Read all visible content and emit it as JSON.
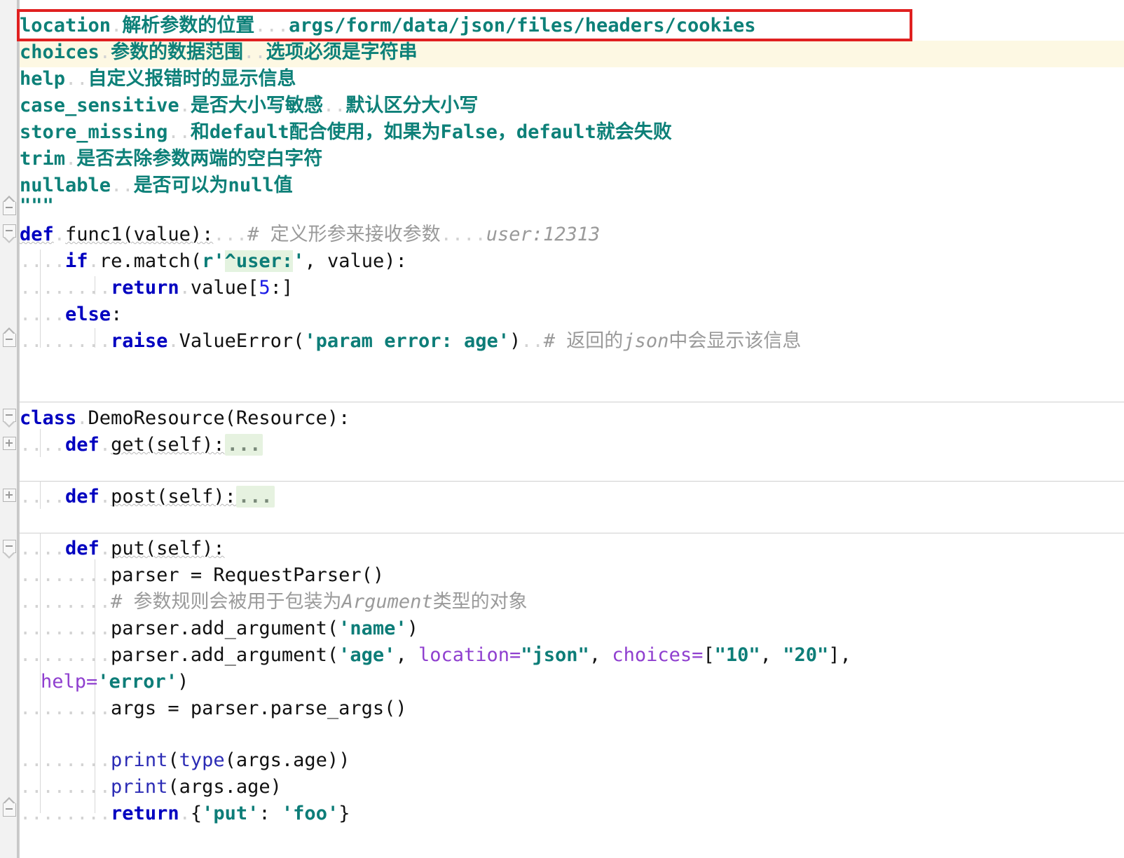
{
  "editor": {
    "language": "python",
    "theme": "light",
    "colors": {
      "background": "#ffffff",
      "gutter": "#f2f2f2",
      "keyword": "#0000c0",
      "string": "#0d7d78",
      "docstring": "#0d8078",
      "comment": "#9a9a9a",
      "number": "#1a1ae6",
      "self_param": "#b070b0",
      "keyword_argument": "#8f3fcf",
      "builtin": "#2b2bb5",
      "current_line_highlight": "#fdf8e3",
      "folded_placeholder_bg": "#e6f2e0",
      "annotation_red": "#e02020"
    }
  },
  "annotation": {
    "name": "red-highlight-box",
    "target_text": "location  解析参数的位置   args/form/data/json/files/headers/cookies"
  },
  "docstring": {
    "entries": [
      {
        "name": "location",
        "desc": "解析参数的位置",
        "extra": "args/form/data/json/files/headers/cookies"
      },
      {
        "name": "choices",
        "desc": "参数的数据范围",
        "extra": "选项必须是字符串"
      },
      {
        "name": "help",
        "desc": "自定义报错时的显示信息",
        "extra": ""
      },
      {
        "name": "case_sensitive",
        "desc": "是否大小写敏感",
        "extra": "默认区分大小写"
      },
      {
        "name": "store_missing",
        "desc": "和default配合使用，如果为False，default就会失败",
        "extra": ""
      },
      {
        "name": "trim",
        "desc": "是否去除参数两端的空白字符",
        "extra": ""
      },
      {
        "name": "nullable",
        "desc": "是否可以为null值",
        "extra": ""
      }
    ],
    "closing_quotes": "\"\"\""
  },
  "code": {
    "func1": {
      "def_keyword": "def",
      "signature": "func1(value):",
      "comment": "# 定义形参来接收参数",
      "comment_italic": "user:12313",
      "if_keyword": "if",
      "if_call_pre": "re.match(",
      "if_regex_prefix": "r'",
      "if_regex_body": "^user:",
      "if_regex_suffix": "'",
      "if_call_post": ", value):",
      "return_keyword": "return",
      "return_expr_pre": "value[",
      "return_index": "5",
      "return_expr_post": ":]",
      "else_keyword": "else",
      "else_colon": ":",
      "raise_keyword": "raise",
      "raise_call_pre": "ValueError(",
      "raise_string": "'param error: age'",
      "raise_call_post": ")",
      "raise_comment": "# 返回的",
      "raise_comment_italic": "json",
      "raise_comment_tail": "中会显示该信息"
    },
    "class_def": {
      "class_keyword": "class",
      "name_and_bases": "DemoResource(Resource):"
    },
    "methods": [
      {
        "def_keyword": "def",
        "signature": "get(self):",
        "folded": "...",
        "collapsed": true
      },
      {
        "def_keyword": "def",
        "signature": "post(self):",
        "folded": "...",
        "collapsed": true
      },
      {
        "def_keyword": "def",
        "signature": "put(self):",
        "folded": "",
        "collapsed": false
      }
    ],
    "put_body": {
      "parser_assign": "parser = RequestParser()",
      "comment": "# 参数规则会被用于包装为",
      "comment_italic": "Argument",
      "comment_tail": "类型的对象",
      "add_name_pre": "parser.add_argument(",
      "add_name_str": "'name'",
      "add_name_post": ")",
      "add_age_pre": "parser.add_argument(",
      "add_age_str": "'age'",
      "add_age_sep": ", ",
      "kwarg_location": "location=",
      "kwarg_location_value": "\"json\"",
      "kwarg_choices": "choices=",
      "choices_open": "[",
      "choice_1": "\"10\"",
      "choices_sep": ", ",
      "choice_2": "\"20\"",
      "choices_close": "],",
      "wrap_kwarg_help": "help=",
      "wrap_help_value": "'error'",
      "wrap_close": ")",
      "args_assign": "args = parser.parse_args()",
      "print_type_fn": "print",
      "print_type_inner_fn": "type",
      "print_type_arg": "(args.age)",
      "print_type_close": ")",
      "print_fn": "print",
      "print_arg": "(args.age)",
      "return_keyword": "return",
      "return_brace_open": "{",
      "return_key": "'put'",
      "return_colon": ": ",
      "return_value": "'foo'",
      "return_brace_close": "}"
    }
  },
  "gutter": {
    "markers": [
      {
        "type": "fold-end-marker",
        "label": "docstring-end"
      },
      {
        "type": "fold-collapse-marker",
        "label": "func1-start"
      },
      {
        "type": "fold-end-marker",
        "label": "func1-end"
      },
      {
        "type": "fold-collapse-marker",
        "label": "class-start"
      },
      {
        "type": "fold-expand-marker",
        "label": "get-method"
      },
      {
        "type": "fold-expand-marker",
        "label": "post-method"
      },
      {
        "type": "fold-collapse-marker",
        "label": "put-method"
      },
      {
        "type": "fold-end-marker",
        "label": "put-method-end"
      }
    ]
  }
}
